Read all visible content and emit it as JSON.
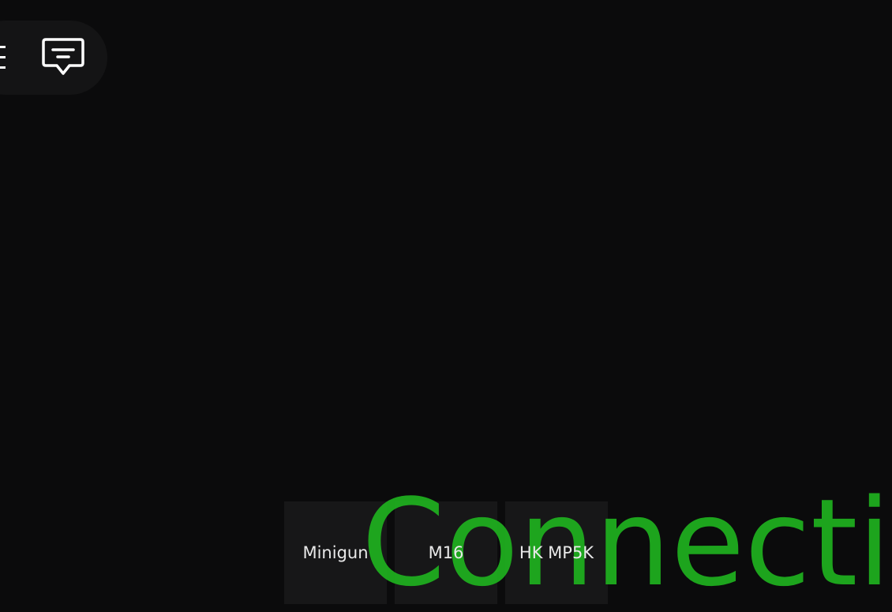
{
  "hud": {
    "menu_icon": "hamburger-menu-icon",
    "chat_icon": "chat-bubble-icon"
  },
  "weapons": [
    {
      "label": "Minigun"
    },
    {
      "label": "M16"
    },
    {
      "label": "HK MP5K"
    }
  ],
  "status": {
    "text": "Connectin",
    "color": "#1fb21f"
  },
  "colors": {
    "background": "#0b0b0c",
    "panel": "#141415",
    "slot": "#171718",
    "text": "#e9e9e9"
  }
}
